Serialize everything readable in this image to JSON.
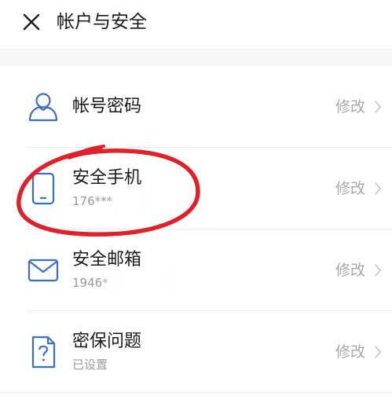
{
  "header": {
    "close_icon": "close-icon",
    "title": "帐户与安全"
  },
  "items": [
    {
      "id": "account-password",
      "icon": "user-icon",
      "title": "帐号密码",
      "subtitle": "",
      "action": "修改"
    },
    {
      "id": "security-phone",
      "icon": "phone-icon",
      "title": "安全手机",
      "subtitle": "176***",
      "action": "修改"
    },
    {
      "id": "security-email",
      "icon": "mail-icon",
      "title": "安全邮箱",
      "subtitle": "1946*",
      "action": "修改"
    },
    {
      "id": "security-question",
      "icon": "question-card-icon",
      "title": "密保问题",
      "subtitle": "已设置",
      "action": "修改"
    }
  ],
  "colors": {
    "icon_blue": "#3b6fc6",
    "annotation_red": "#e0202a",
    "text_primary": "#1a1a1a",
    "text_secondary": "#9a9a9a",
    "action_gray": "#a8a8a8"
  }
}
